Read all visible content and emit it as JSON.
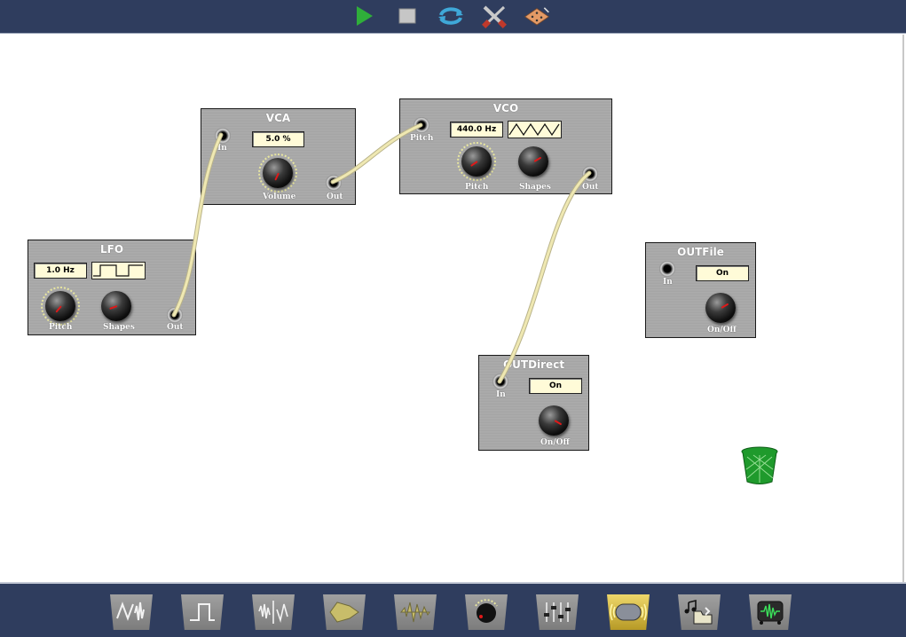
{
  "toolbar": {
    "icons": [
      "play-icon",
      "stop-icon",
      "refresh-icon",
      "tools-icon",
      "map-icon"
    ]
  },
  "modules": {
    "vca": {
      "title": "VCA",
      "volume_value": "5.0 %",
      "in_label": "In",
      "volume_label": "Volume",
      "out_label": "Out"
    },
    "vco": {
      "title": "VCO",
      "freq_value": "440.0 Hz",
      "waveform": "triangle",
      "pitch_in_label": "Pitch",
      "pitch_label": "Pitch",
      "shapes_label": "Shapes",
      "out_label": "Out"
    },
    "lfo": {
      "title": "LFO",
      "freq_value": "1.0 Hz",
      "waveform": "square",
      "pitch_label": "Pitch",
      "shapes_label": "Shapes",
      "out_label": "Out"
    },
    "outfile": {
      "title": "OUTFile",
      "state_value": "On",
      "in_label": "In",
      "onoff_label": "On/Off"
    },
    "outdirect": {
      "title": "OUTDirect",
      "state_value": "On",
      "in_label": "In",
      "onoff_label": "On/Off"
    }
  },
  "trash": {
    "icon": "trash-icon"
  },
  "palette": {
    "items": [
      "lfo-vco-icon",
      "square-wave-icon",
      "noise-wave-icon",
      "envelope-icon",
      "sample-icon",
      "knob-icon",
      "mixer-icon",
      "speaker-icon",
      "music-file-icon",
      "oscilloscope-icon"
    ],
    "active_index": 7
  },
  "colors": {
    "toolbar_bg": "#2f3d5e",
    "cable": "#efe8b2",
    "value_box": "#fffbd8",
    "play": "#2fae3a",
    "trash": "#1f9a2c"
  }
}
